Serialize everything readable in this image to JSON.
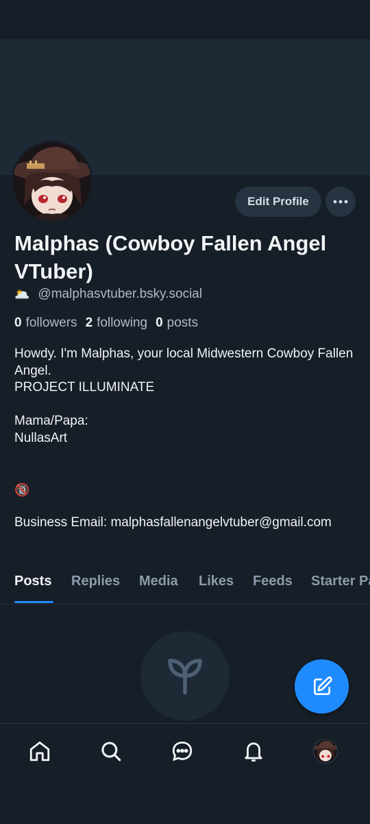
{
  "profile": {
    "display_name": "Malphas (Cowboy Fallen Angel VTuber)",
    "handle_emoji": "🌥️",
    "handle": "@malphasvtuber.bsky.social",
    "followers_count": "0",
    "followers_label": "followers",
    "following_count": "2",
    "following_label": "following",
    "posts_count": "0",
    "posts_label": "posts",
    "bio_text": "Howdy. I'm Malphas, your local Midwestern Cowboy Fallen Angel.\nPROJECT ILLUMINATE\n\nMama/Papa:\nNullasArt",
    "bio_emoji": "🔞",
    "bio_email": "Business Email: malphasfallenangelvtuber@gmail.com"
  },
  "actions": {
    "edit_profile_label": "Edit Profile"
  },
  "tabs": [
    {
      "label": "Posts"
    },
    {
      "label": "Replies"
    },
    {
      "label": "Media"
    },
    {
      "label": "Likes"
    },
    {
      "label": "Feeds"
    },
    {
      "label": "Starter Packs"
    }
  ],
  "nav": {
    "items": [
      "home-icon",
      "search-icon",
      "chat-icon",
      "notifications-icon",
      "profile-avatar"
    ]
  },
  "colors": {
    "background": "#161e27",
    "banner": "#1e2936",
    "accent": "#1f8bff",
    "button_bg": "#263341"
  }
}
